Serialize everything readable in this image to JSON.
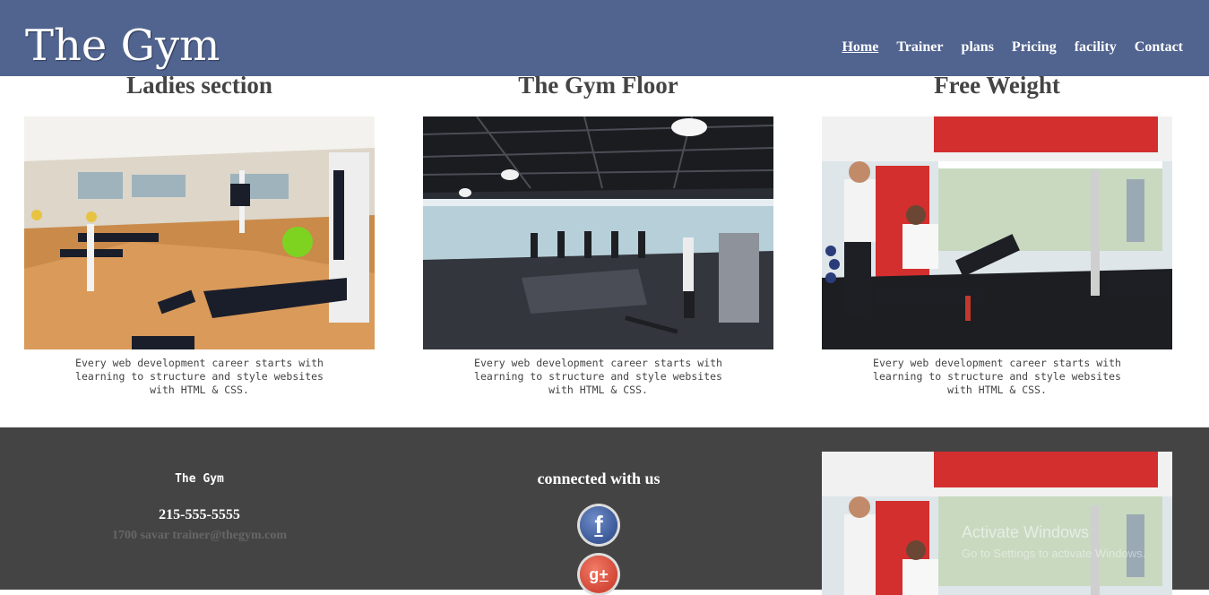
{
  "header": {
    "logo": "The Gym",
    "nav": [
      {
        "label": "Home",
        "active": true
      },
      {
        "label": "Trainer"
      },
      {
        "label": "plans"
      },
      {
        "label": "Pricing"
      },
      {
        "label": "facility"
      },
      {
        "label": "Contact"
      }
    ]
  },
  "sections": [
    {
      "title": "Ladies section",
      "desc": "Every web development career starts with learning to structure and style websites with HTML & CSS."
    },
    {
      "title": "The Gym Floor",
      "desc": "Every web development career starts with learning to structure and style websites with HTML & CSS."
    },
    {
      "title": "Free Weight",
      "desc": "Every web development career starts with learning to structure and style websites with HTML & CSS."
    }
  ],
  "footer": {
    "name": "The Gym",
    "phone": "215-555-5555",
    "address": "1700 savar trainer@thegym.com",
    "connected": "connected with us",
    "facebook_glyph": "f",
    "google_glyph": "g+"
  },
  "watermark": {
    "line1": "Activate Windows",
    "line2": "Go to Settings to activate Windows."
  },
  "colors": {
    "header_bg": "#51648f",
    "footer_bg": "#444444",
    "accent_red": "#d32f2f"
  }
}
